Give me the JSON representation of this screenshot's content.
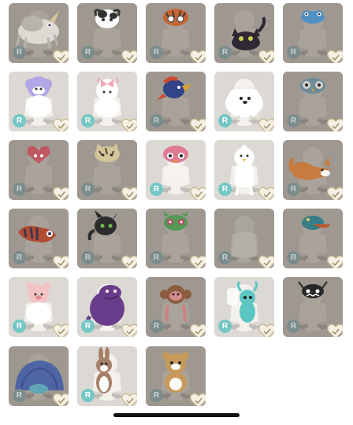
{
  "badge_label": "R",
  "colors": {
    "locked_bg": "#9e9890",
    "unlocked_bg": "#dcd9d4",
    "badge_locked": "#7c8c8c",
    "badge_unlocked": "#74c7c4",
    "heart_fill": "#f5f0e4",
    "heart_stroke": "#c8b891"
  },
  "items": [
    {
      "name": "gray-unicorn-hat",
      "state": "locked",
      "icon": "unicorn-icon",
      "accent": "#b9b4ae",
      "accent2": "#e0ddd8"
    },
    {
      "name": "cow-hat",
      "state": "locked",
      "icon": "cow-icon",
      "accent": "#ffffff",
      "accent2": "#2b2b2b"
    },
    {
      "name": "tiger-goggles-hat",
      "state": "locked",
      "icon": "tiger-icon",
      "accent": "#c9612c",
      "accent2": "#333333"
    },
    {
      "name": "black-cat-hat",
      "state": "locked",
      "icon": "black-cat-icon",
      "accent": "#2a2330",
      "accent2": "#cdd34b"
    },
    {
      "name": "blue-frog-hat",
      "state": "locked",
      "icon": "frog-icon",
      "accent": "#4d8fc7",
      "accent2": "#2c5c8a"
    },
    {
      "name": "purple-sheep-hat",
      "state": "unlocked",
      "icon": "sheep-icon",
      "accent": "#b3a6e6",
      "accent2": "#ffffff"
    },
    {
      "name": "pink-bow-hat",
      "state": "unlocked",
      "icon": "bow-icon",
      "accent": "#f0a6b4",
      "accent2": "#ffffff"
    },
    {
      "name": "parrot-hat",
      "state": "locked",
      "icon": "parrot-icon",
      "accent": "#2c3f86",
      "accent2": "#d0462c"
    },
    {
      "name": "white-dog-costume",
      "state": "unlocked",
      "icon": "dog-icon",
      "accent": "#ffffff",
      "accent2": "#8c8a86"
    },
    {
      "name": "blue-owl-hat",
      "state": "locked",
      "icon": "owl-icon",
      "accent": "#6b8a9a",
      "accent2": "#3f5560"
    },
    {
      "name": "red-heart-hat",
      "state": "locked",
      "icon": "heart-hat-icon",
      "accent": "#c2545f",
      "accent2": "#ffffff"
    },
    {
      "name": "tabby-cat-hat",
      "state": "locked",
      "icon": "tabby-icon",
      "accent": "#d6c79a",
      "accent2": "#4a4030"
    },
    {
      "name": "pink-bird-hat",
      "state": "unlocked",
      "icon": "pink-bird-icon",
      "accent": "#e07a93",
      "accent2": "#6c3c4a"
    },
    {
      "name": "white-bird-costume",
      "state": "unlocked",
      "icon": "white-bird-icon",
      "accent": "#ffffff",
      "accent2": "#f0c23c"
    },
    {
      "name": "fox-tail",
      "state": "locked",
      "icon": "fox-icon",
      "accent": "#c97a3c",
      "accent2": "#ffffff"
    },
    {
      "name": "red-panda-tail",
      "state": "locked",
      "icon": "red-panda-icon",
      "accent": "#b0482c",
      "accent2": "#3a3050"
    },
    {
      "name": "black-dragon-hat",
      "state": "locked",
      "icon": "dragon-icon",
      "accent": "#262626",
      "accent2": "#6cbf4a"
    },
    {
      "name": "green-monster-hat",
      "state": "locked",
      "icon": "green-monster-icon",
      "accent": "#4f9a52",
      "accent2": "#b84a6a"
    },
    {
      "name": "ghost-costume",
      "state": "locked",
      "icon": "ghost-icon",
      "accent": "#aaa59f",
      "accent2": "#b4afa9"
    },
    {
      "name": "teal-cap",
      "state": "locked",
      "icon": "cap-icon",
      "accent": "#2f7c86",
      "accent2": "#c0562c"
    },
    {
      "name": "pink-bear-hat",
      "state": "unlocked",
      "icon": "pink-bear-icon",
      "accent": "#f2c4c6",
      "accent2": "#ffffff"
    },
    {
      "name": "purple-dino-costume",
      "state": "unlocked",
      "icon": "purple-dino-icon",
      "accent": "#6a3c8c",
      "accent2": "#4a2a64"
    },
    {
      "name": "pink-monkey-hat",
      "state": "locked",
      "icon": "monkey-icon",
      "accent": "#d98c8c",
      "accent2": "#8a5a3c"
    },
    {
      "name": "teal-fairy-costume",
      "state": "unlocked",
      "icon": "fairy-icon",
      "accent": "#5cc6c4",
      "accent2": "#ffffff"
    },
    {
      "name": "black-beetle-hat",
      "state": "locked",
      "icon": "beetle-icon",
      "accent": "#222222",
      "accent2": "#ffffff"
    },
    {
      "name": "blue-shell-costume",
      "state": "locked",
      "icon": "shell-icon",
      "accent": "#4a62a6",
      "accent2": "#3a4a8a"
    },
    {
      "name": "bunny-costume",
      "state": "unlocked",
      "icon": "bunny-icon",
      "accent": "#a7806a",
      "accent2": "#ffffff"
    },
    {
      "name": "teddy-bear-costume",
      "state": "locked",
      "icon": "teddy-icon",
      "accent": "#c99a56",
      "accent2": "#ffffff"
    }
  ]
}
